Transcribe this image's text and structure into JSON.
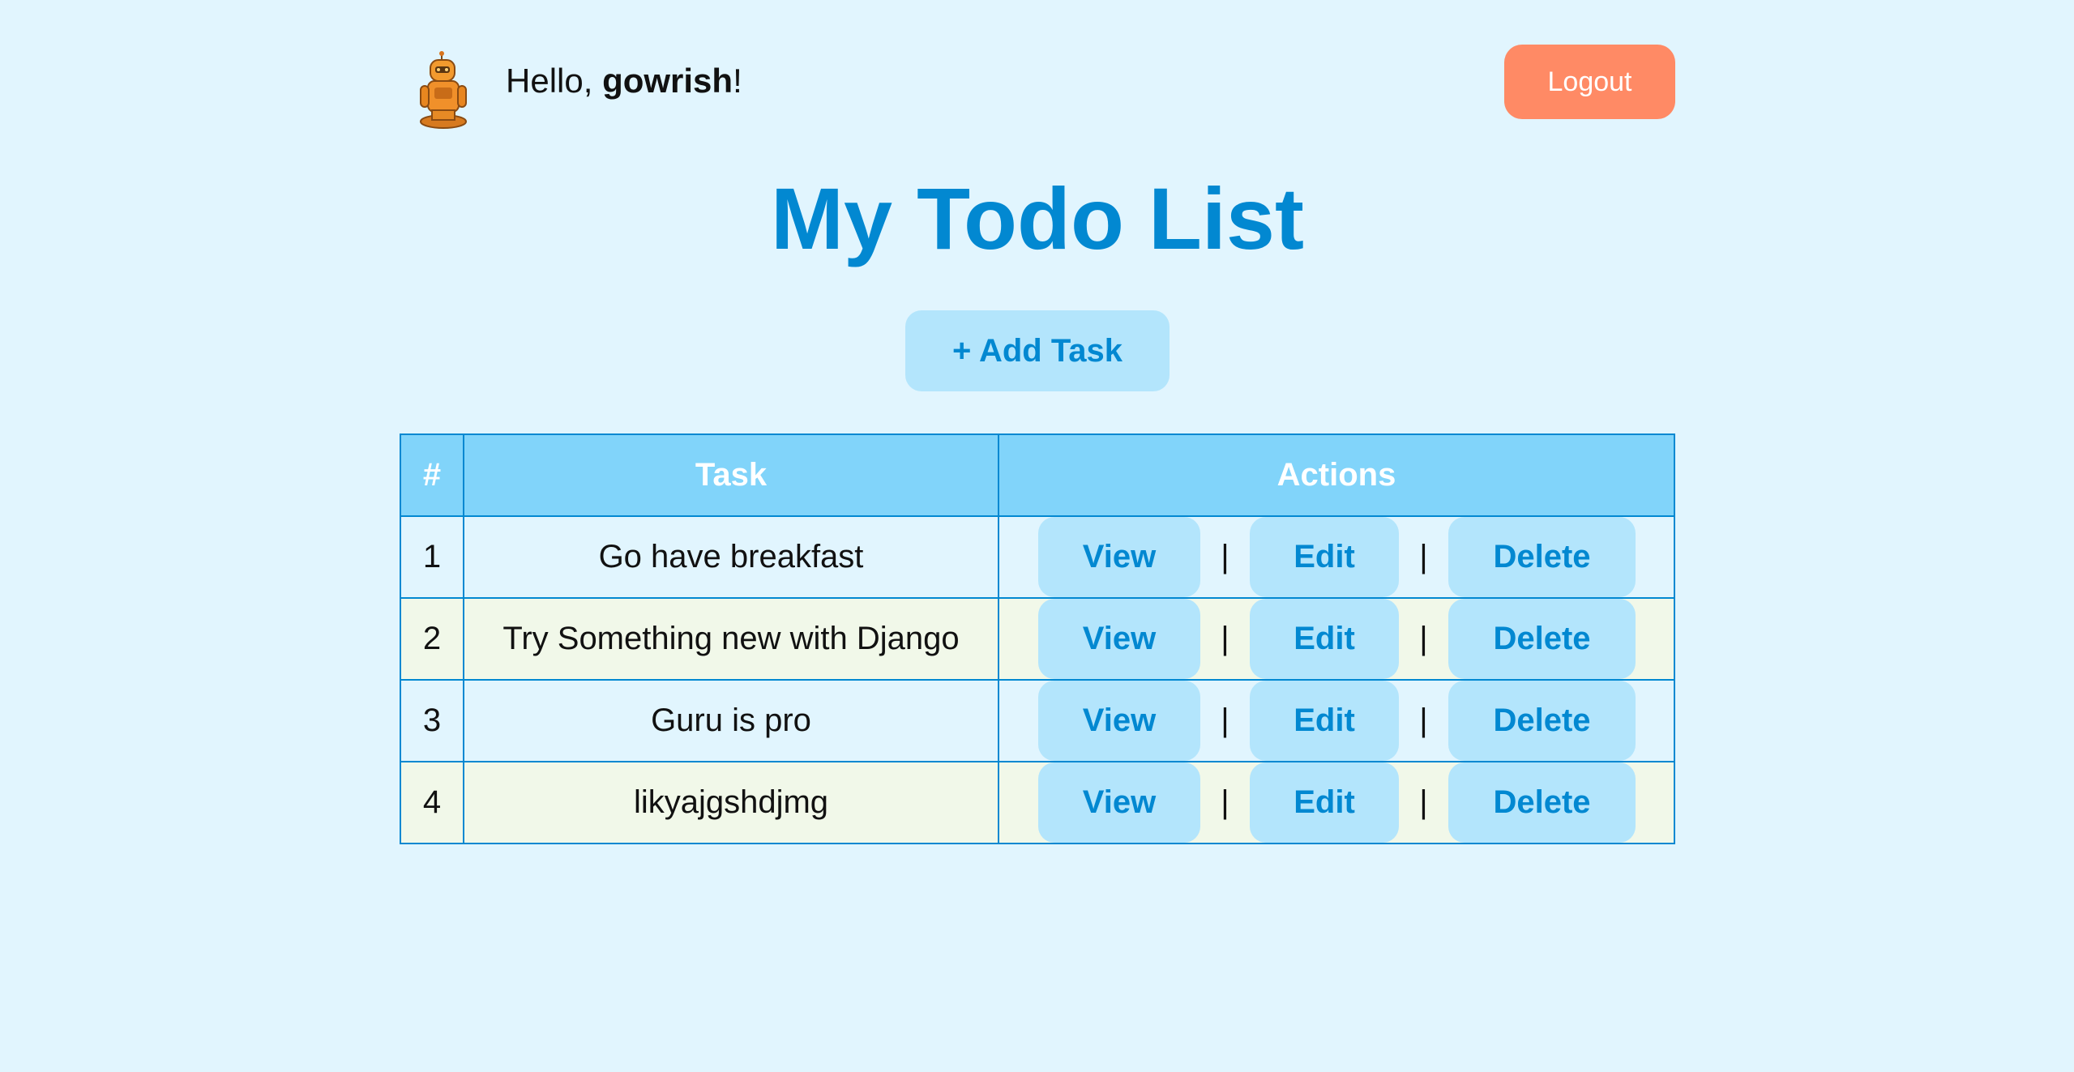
{
  "header": {
    "greeting_prefix": "Hello, ",
    "username": "gowrish",
    "greeting_suffix": "!",
    "logout_label": "Logout"
  },
  "page_title": "My Todo List",
  "add_task_label": "+ Add Task",
  "table": {
    "headers": [
      "#",
      "Task",
      "Actions"
    ],
    "rows": [
      {
        "num": "1",
        "task": "Go have breakfast"
      },
      {
        "num": "2",
        "task": "Try Something new with Django"
      },
      {
        "num": "3",
        "task": "Guru is pro"
      },
      {
        "num": "4",
        "task": "likyajgshdjmg"
      }
    ],
    "action_labels": {
      "view": "View",
      "edit": "Edit",
      "delete": "Delete",
      "separator": "|"
    }
  },
  "colors": {
    "background": "#e1f5fe",
    "accent": "#0288d1",
    "header_bg": "#81d4fa",
    "button_bg": "#b3e5fc",
    "logout_bg": "#ff8a65",
    "alt_row_bg": "#f1f8e9"
  },
  "icons": {
    "avatar": "robot-avatar-icon"
  }
}
